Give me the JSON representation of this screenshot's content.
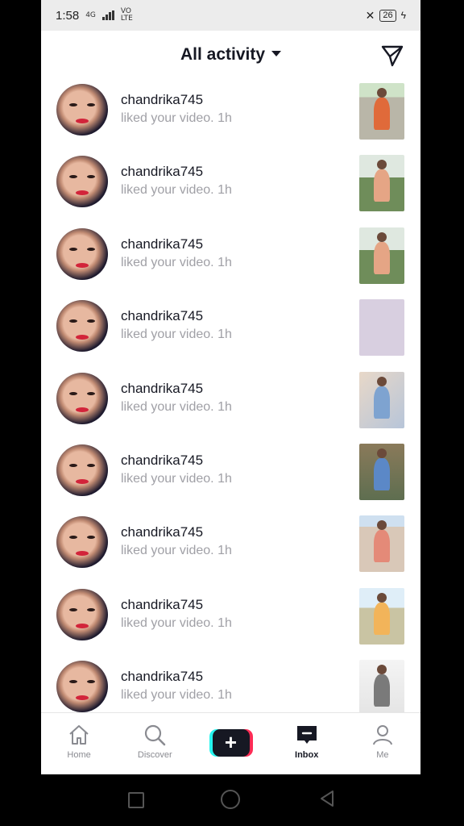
{
  "status_bar": {
    "time": "1:58",
    "network_small": "4G",
    "volte": "VO LTE",
    "battery": "26"
  },
  "header": {
    "title": "All activity",
    "dropdown_icon": "caret-down-icon",
    "send_icon": "paper-plane-icon"
  },
  "notifications": [
    {
      "username": "chandrika745",
      "message": "liked your video. 1h",
      "thumb": "field-kid"
    },
    {
      "username": "chandrika745",
      "message": "liked your video. 1h",
      "thumb": "sitting-man"
    },
    {
      "username": "chandrika745",
      "message": "liked your video. 1h",
      "thumb": "sitting-man"
    },
    {
      "username": "chandrika745",
      "message": "liked your video. 1h",
      "thumb": "lavender-blank"
    },
    {
      "username": "chandrika745",
      "message": "liked your video. 1h",
      "thumb": "boy-selfie"
    },
    {
      "username": "chandrika745",
      "message": "liked your video. 1h",
      "thumb": "boy-sitting"
    },
    {
      "username": "chandrika745",
      "message": "liked your video. 1h",
      "thumb": "road-walker"
    },
    {
      "username": "chandrika745",
      "message": "liked your video. 1h",
      "thumb": "field-boy"
    },
    {
      "username": "chandrika745",
      "message": "liked your video. 1h",
      "thumb": "boy-portrait"
    }
  ],
  "bottom_nav": {
    "home": "Home",
    "discover": "Discover",
    "inbox": "Inbox",
    "me": "Me"
  },
  "colors": {
    "text_primary": "#161823",
    "text_secondary": "#a0a0a6",
    "accent_cyan": "#25f4ee",
    "accent_pink": "#fe2c55"
  }
}
